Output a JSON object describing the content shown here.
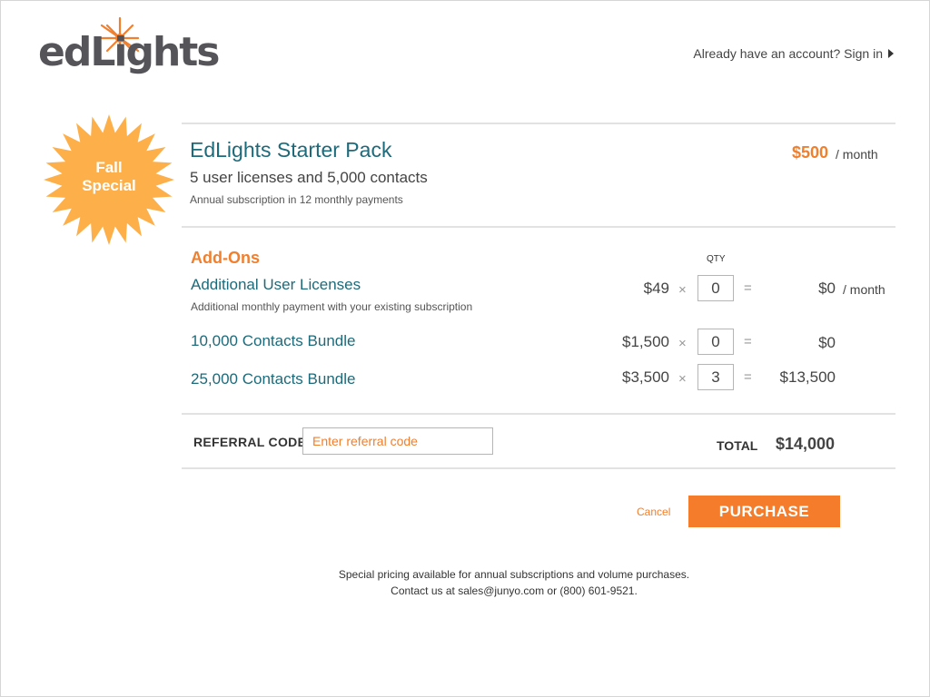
{
  "brand": {
    "logo_text": "edLights",
    "accent_color": "#f07f2e",
    "teal_color": "#1d6a7a"
  },
  "header": {
    "signin_text": "Already have an account? Sign in"
  },
  "badge": {
    "line1": "Fall",
    "line2": "Special",
    "color": "#fdb04a"
  },
  "plan": {
    "title": "EdLights Starter Pack",
    "subtitle": "5 user licenses and 5,000 contacts",
    "note": "Annual subscription in 12 monthly payments",
    "price": "$500",
    "unit": "/ month"
  },
  "addons": {
    "title": "Add-Ons",
    "qty_label": "QTY",
    "items": [
      {
        "name": "Additional User Licenses",
        "note": "Additional monthly payment with your existing subscription",
        "price": "$49",
        "qty": "0",
        "total": "$0",
        "unit": "/ month"
      },
      {
        "name": "10,000 Contacts Bundle",
        "price": "$1,500",
        "qty": "0",
        "total": "$0"
      },
      {
        "name": "25,000 Contacts Bundle",
        "price": "$3,500",
        "qty": "3",
        "total": "$13,500"
      }
    ],
    "times_symbol": "×",
    "equals_symbol": "="
  },
  "referral": {
    "label": "REFERRAL CODE",
    "placeholder": "Enter referral code"
  },
  "total": {
    "label": "TOTAL",
    "value": "$14,000"
  },
  "actions": {
    "cancel_label": "Cancel",
    "purchase_label": "PURCHASE"
  },
  "footer": {
    "line1": "Special pricing available for annual subscriptions and volume purchases.",
    "line2": "Contact us at sales@junyo.com or (800) 601-9521."
  }
}
